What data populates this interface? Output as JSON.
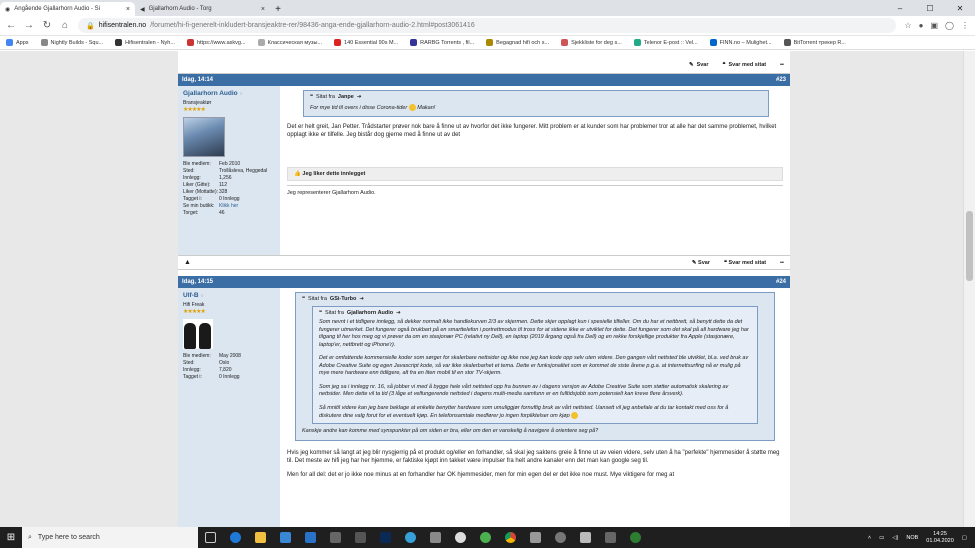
{
  "browser": {
    "tabs": [
      {
        "title": "Angående Gjallarhorn Audio - Si",
        "close": "×"
      },
      {
        "title": "Gjallarhorn Audio - Torg",
        "close": "×"
      }
    ],
    "new_tab": "+",
    "url_domain": "hifisentralen.no",
    "url_path": "/forumet/hi-fi-generelt-inkludert-bransjeaktre-rer/98436-anga-ende-gjallarhorn-audio-2.html#post3061416",
    "bookmarks": [
      "Apps",
      "Nightly Builds - Squ...",
      "Hifisentralen - Nyh...",
      "https://www.askvg...",
      "Классическая музы...",
      "140 Essential 90s M...",
      "RARBG Torrents , fil...",
      "Begagnad hifi och s...",
      "Sjekkliste for deg s...",
      "Telenor E-post :: Vel...",
      "FINN.no – Mulighet...",
      "BitTorrent трекер R..."
    ]
  },
  "toolbar": {
    "reply": "Svar",
    "reply_quote": "Svar med sitat"
  },
  "posts": [
    {
      "date": "Idag, 14:14",
      "number": "#23",
      "user": "Gjallarhorn Audio",
      "rank": "Bransjeaktør",
      "meta": [
        {
          "k": "Ble medlem:",
          "v": "Feb 2010"
        },
        {
          "k": "Sted:",
          "v": "Trollåsleva, Heggedal"
        },
        {
          "k": "Innlegg:",
          "v": "1,256"
        },
        {
          "k": "Liker (Gitte):",
          "v": "112"
        },
        {
          "k": "Liker (Mottatte):",
          "v": "328"
        },
        {
          "k": "Tagget i:",
          "v": "0 Innlegg"
        },
        {
          "k": "Se min butikk:",
          "v": "Klikk her"
        },
        {
          "k": "Torget:",
          "v": "46"
        }
      ],
      "quote_from": "Sitat fra",
      "quote_user": "Janpe",
      "quote_text": "For mye tid til overs i disse Corona-tider",
      "quote_tail": "Makan!",
      "text": "Det er helt greit, Jan Petter. Trådstarter prøver nok bare å finne ut av hvorfor det ikke fungerer. Mitt problem er at kunder som har problemer tror at alle har det samme problemet, hvilket opplagt ikke er tilfelle. Jeg bistår dog gjerne med å finne ut av det",
      "like": "Jeg liker dette innlegget",
      "signature": "Jeg representerer Gjallarhorn Audio."
    },
    {
      "date": "Idag, 14:15",
      "number": "#24",
      "user": "Ulf-B",
      "rank": "Hifi Freak",
      "meta": [
        {
          "k": "Ble medlem:",
          "v": "May 2008"
        },
        {
          "k": "Sted:",
          "v": "Oslo"
        },
        {
          "k": "Innlegg:",
          "v": "7,820"
        },
        {
          "k": "Tagget i:",
          "v": "0 Innlegg"
        }
      ],
      "quote_user": "GSi-Turbo",
      "inner_quote_user": "Gjallarhorn Audio",
      "inner_paragraphs": [
        "Som nevnt i et tidligere innlegg, så dekker normalt ikke handlekurven 2/3 av skjermen. Dette skjer opplagt kun i spesielle tilfeller. Om du har et nettbrett, så benytt dette da det fungerer utmerket. Det fungerer også brukbart på en smarttelefon i portrettmodus til tross for at sidene ikke er utviklet for dette. Det fungerer som det skal på all hardware jeg har tilgang til her hos meg og vi prøver da om en stasjonær PC (relativt ny Dell), en laptop (2019 årgang også fra Dell) og en rekke forskjellige produkter fra Apple (stasjonære, laptop'er, nettbrett og iPhone'r).",
        "Det er omfattende kommersielle koder som sørger for skalerbare nettsider og ikke noe jeg kan kode opp selv uten videre. Den gangen vårt nettsted ble utviklet, bl.a. ved bruk av Adobe Creative Suite og egen Javascript kode, så var ikke skalerbarhet et tema. Dette er funksjonalitet som er kommet de siste årene p.g.a. at internettsurfing nå er mulig på mye mere hardware enn tidligere, alt fra en liten mobil til en stor TV-skjerm.",
        "Som jeg sa i innlegg nr. 16, så jobber vi med å bygge hele vårt nettsted opp fra bunnen av i dagens versjon av Adobe Creative Suite som støtter automatisk skalering av nettsider. Men dette vil ta tid (3 låge et velfungerende nettsted i dagens multi-media samfunn er en fulltidsjobb som potensielt kan kreve flere årsverk).",
        "Så mnitil videre kan jeg bare beklage at enkelte benytter hardware som umuliggjør fornuftig bruk av vårt nettsted. Uansett vil jeg anbefale at du tar kontakt med oss for å diskutere dine valg forut for et eventuelt kjøp. En telefonsamtale medfører jo ingen forpliktelser om kjøp"
      ],
      "outer_quote_text": "Kanskje andre kan komme med synspunkter på om siden er bra, eller om den er vanskelig å navigere å orientere seg på?",
      "text": "Hvis jeg kommer så langt at jeg blir nysgjerrig på et produkt og/eller en forhandler, så skal jeg saktens greie å finne ut av veien videre, selv uten å ha \"perfekte\" hjemmesider å støtte meg til. Det meste av hifi jeg har her hjemme, er faktiske kjøpt inn takket være impulser fra helt andre kanaler enn det man kan google seg til.",
      "text2": "Men for all del: det er jo ikke noe minus at en forhandler har OK hjemmesider, men for min egen del er det ikke noe must. Mye viktigere for meg at"
    }
  ],
  "taskbar": {
    "search": "Type here to search",
    "lang": "NOB",
    "time": "14:25",
    "date": "01.04.2020"
  }
}
